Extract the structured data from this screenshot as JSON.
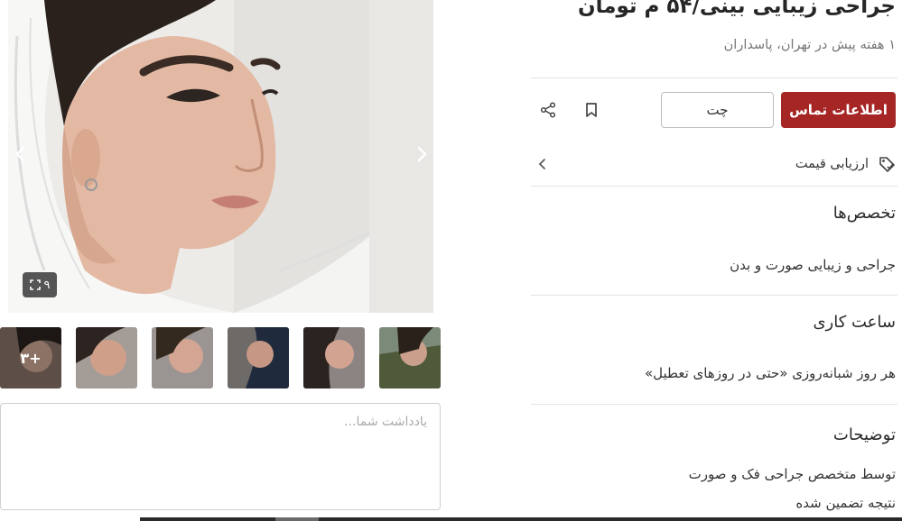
{
  "listing": {
    "title": "جراحی زیبایی بینی/۵۴ م تومان",
    "meta": "۱ هفته پیش در تهران، پاسداران"
  },
  "actions": {
    "contact_label": "اطلاعات تماس",
    "chat_label": "چت",
    "bookmark_icon": "bookmark-icon",
    "share_icon": "share-icon"
  },
  "price_evaluation": {
    "label": "ارزیابی قیمت",
    "icon": "price-tag-icon"
  },
  "sections": {
    "specialties": {
      "title": "تخصص‌ها",
      "value": "جراحی و زیبایی صورت و بدن"
    },
    "working_hours": {
      "title": "ساعت کاری",
      "value": "هر روز شبانه‌روزی «حتی در روزهای تعطیل»"
    },
    "description": {
      "title": "توضیحات",
      "lines": [
        "توسط متخصص جراحی فک و صورت",
        "نتیجه تضمین شده"
      ]
    }
  },
  "gallery": {
    "image_count": "۹",
    "more_thumbs": "+۳"
  },
  "note": {
    "placeholder": "یادداشت شما..."
  },
  "colors": {
    "accent": "#a62626",
    "divider": "#e4e4e4",
    "muted_text": "#777777"
  }
}
